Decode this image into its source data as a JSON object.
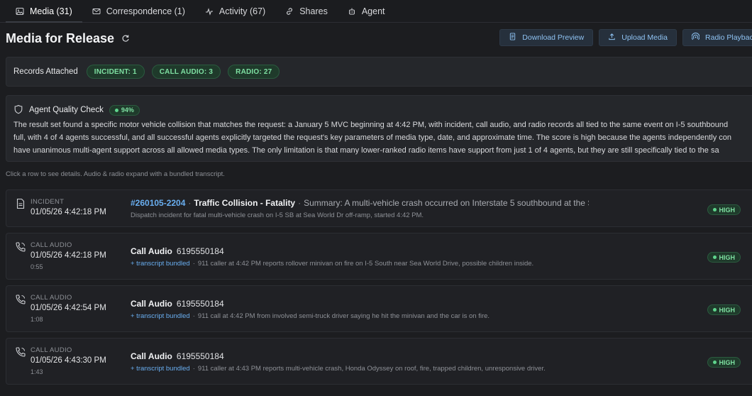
{
  "tabs": [
    {
      "label": "Media (31)",
      "icon": "image-icon"
    },
    {
      "label": "Correspondence (1)",
      "icon": "mail-icon"
    },
    {
      "label": "Activity (67)",
      "icon": "activity-icon"
    },
    {
      "label": "Shares",
      "icon": "share-icon"
    },
    {
      "label": "Agent",
      "icon": "bot-icon"
    }
  ],
  "header": {
    "title": "Media for Release",
    "buttons": {
      "download": "Download Preview",
      "upload": "Upload Media",
      "radio": "Radio Playback"
    }
  },
  "records": {
    "label": "Records Attached",
    "chips": [
      "INCIDENT: 1",
      "CALL AUDIO: 3",
      "RADIO: 27"
    ]
  },
  "quality": {
    "title": "Agent Quality Check",
    "score": "94%",
    "lines": [
      "The result set found a specific motor vehicle collision that matches the request: a January 5 MVC beginning at 4:42 PM, with incident, call audio, and radio records all tied to the same event on I-5 southbound",
      "full, with 4 of 4 agents successful, and all successful agents explicitly targeted the request's key parameters of media type, date, and approximate time. The score is high because the agents independently con",
      "have unanimous multi-agent support across all allowed media types. The only limitation is that many lower-ranked radio items have support from just 1 of 4 agents, but they are still specifically tied to the sa"
    ]
  },
  "hint": "Click a row to see details. Audio & radio expand with a bundled transcript.",
  "rows": [
    {
      "kind": "INCIDENT",
      "time": "01/05/26 4:42:18 PM",
      "id": "#260105-2204",
      "title": "Traffic Collision - Fatality",
      "summary": "Summary: A multi-vehicle crash occurred on Interstate 5 southbound at the Sea W...",
      "detail": "Dispatch incident for fatal multi-vehicle crash on I-5 SB at Sea World Dr off-ramp, started 4:42 PM.",
      "badge": "HIGH"
    },
    {
      "kind": "CALL AUDIO",
      "time": "01/05/26 4:42:18 PM",
      "duration": "0:55",
      "title": "Call Audio",
      "phone": "6195550184",
      "bundle": "+ transcript bundled",
      "detail": "911 caller at 4:42 PM reports rollover minivan on fire on I-5 South near Sea World Drive, possible children inside.",
      "badge": "HIGH"
    },
    {
      "kind": "CALL AUDIO",
      "time": "01/05/26 4:42:54 PM",
      "duration": "1:08",
      "title": "Call Audio",
      "phone": "6195550184",
      "bundle": "+ transcript bundled",
      "detail": "911 call at 4:42 PM from involved semi-truck driver saying he hit the minivan and the car is on fire.",
      "badge": "HIGH"
    },
    {
      "kind": "CALL AUDIO",
      "time": "01/05/26 4:43:30 PM",
      "duration": "1:43",
      "title": "Call Audio",
      "phone": "6195550184",
      "bundle": "+ transcript bundled",
      "detail": "911 caller at 4:43 PM reports multi-vehicle crash, Honda Odyssey on roof, fire, trapped children, unresponsive driver.",
      "badge": "HIGH"
    }
  ]
}
